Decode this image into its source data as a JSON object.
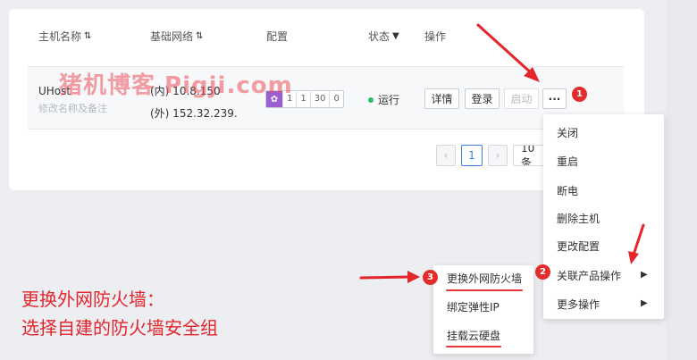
{
  "table": {
    "headers": {
      "host_name": "主机名称",
      "network": "基础网络",
      "config": "配置",
      "status": "状态",
      "actions": "操作"
    },
    "row": {
      "name": "UHost",
      "note": "修改名称及备注",
      "ip_internal": "(内) 10.8.150",
      "ip_external": "(外) 152.32.239.",
      "spec": [
        "1",
        "1",
        "30",
        "0"
      ],
      "status": "运行",
      "buttons": {
        "detail": "详情",
        "login": "登录",
        "start": "启动",
        "more": "···"
      }
    }
  },
  "pagination": {
    "current": "1",
    "page_size": "10 条"
  },
  "dropdown_menu": {
    "items": [
      "关闭",
      "重启",
      "断电",
      "删除主机",
      "更改配置",
      "关联产品操作",
      "更多操作"
    ]
  },
  "submenu": {
    "items": [
      "更换外网防火墙",
      "绑定弹性IP",
      "挂载云硬盘"
    ]
  },
  "annotations": {
    "watermark": "猪机博客 Pigji.com",
    "markers": [
      "1",
      "2",
      "3"
    ],
    "note_line1": "更换外网防火墙：",
    "note_line2": "选择自建的防火墙安全组"
  },
  "colors": {
    "accent": "#3a7be4",
    "annotation_red": "#e4262c",
    "status_green": "#2dbe60",
    "spec_badge": "#9c5fd1"
  },
  "icons": [
    "sort-icon",
    "filter-icon",
    "flower-icon",
    "chevron-left-icon",
    "chevron-right-icon",
    "caret-right-icon",
    "red-arrow-icon"
  ]
}
